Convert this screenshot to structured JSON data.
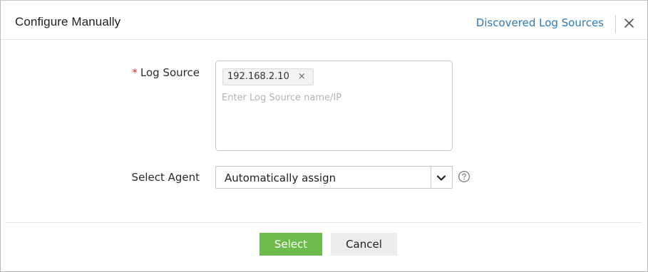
{
  "dialog": {
    "title": "Configure Manually",
    "discovered_link": "Discovered Log Sources",
    "close_icon": "close-icon"
  },
  "form": {
    "log_source": {
      "required_marker": "*",
      "label": "Log Source",
      "tags": [
        {
          "value": "192.168.2.10",
          "remove_glyph": "×"
        }
      ],
      "placeholder": "Enter Log Source name/IP",
      "value": ""
    },
    "agent": {
      "label": "Select Agent",
      "selected": "Automatically assign",
      "chevron_icon": "chevron-down-icon",
      "help_icon": "help-circle-icon"
    }
  },
  "footer": {
    "select_label": "Select",
    "cancel_label": "Cancel"
  },
  "colors": {
    "link": "#2b7bb9",
    "required": "#e0312b",
    "primary_button": "#6dbb4b",
    "secondary_button": "#ececec"
  }
}
